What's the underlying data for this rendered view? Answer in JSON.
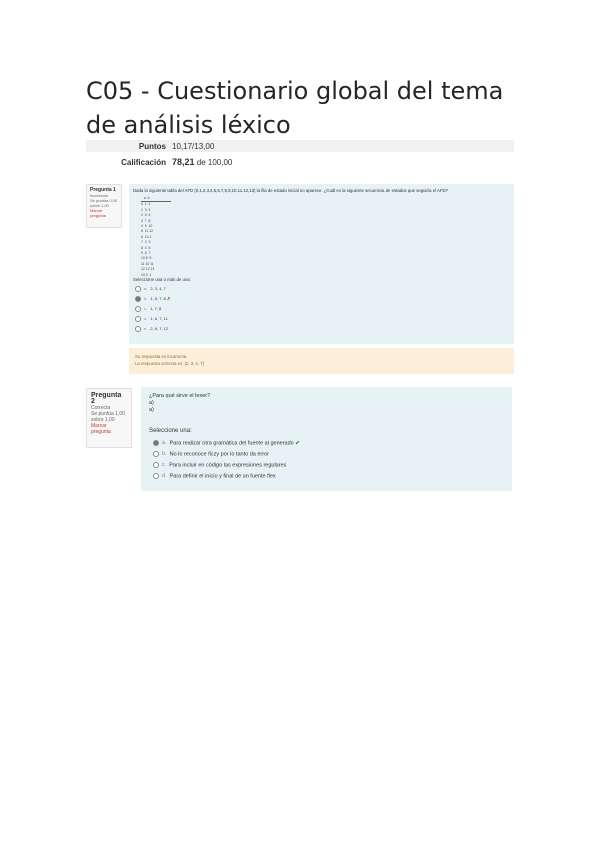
{
  "title": "C05 - Cuestionario global del tema de análisis léxico",
  "summary": {
    "puntos_label": "Puntos",
    "puntos_value": "10,17/13,00",
    "calificacion_label": "Calificación",
    "calificacion_value": "78,21",
    "calificacion_suffix": "de 100,00"
  },
  "q1": {
    "number": "Pregunta 1",
    "state": "Incorrecta",
    "score": "Se puntúa 0,00 sobre 1,00",
    "flag": "Marcar pregunta",
    "text": "Dada la siguiente tabla del AFD (0,1,2,3,4,5,6,7,8,9,10,11,12,13) la fila de estado inicial no aparece. ¿Cuál es la siguiente secuencia de estados que seguiría el AFD?",
    "prompt": "Seleccione una o más de una:",
    "options": [
      {
        "letter": "a.",
        "text": "2, 3, 4, 7",
        "mark": ""
      },
      {
        "letter": "b.",
        "text": "1, 5, 7, 8",
        "mark": "✗"
      },
      {
        "letter": "c.",
        "text": "1, 7, 8",
        "mark": ""
      },
      {
        "letter": "d.",
        "text": "1, 6, 7, 11",
        "mark": ""
      },
      {
        "letter": "e.",
        "text": "2, 6, 7, 12",
        "mark": ""
      }
    ],
    "feedback_line1": "Su respuesta es incorrecta.",
    "feedback_line2": "La respuesta correcta es: [2, 3, 4, 7]"
  },
  "q2": {
    "number": "Pregunta 2",
    "state": "Correcta",
    "score": "Se puntúa 1,00 sobre 1,00",
    "flag": "Marcar pregunta",
    "text_line1": "¿Para qué sirve el lexer?",
    "text_line2": "a)",
    "text_line3": "a)",
    "prompt": "Seleccione una:",
    "options": [
      {
        "letter": "a.",
        "text": "Para realizar otra gramática del fuente al generado",
        "mark": "✔"
      },
      {
        "letter": "b.",
        "text": "No lo reconoce ficzy por lo tanto da error",
        "mark": ""
      },
      {
        "letter": "c.",
        "text": "Para incluir en código las expresiones regulares",
        "mark": ""
      },
      {
        "letter": "d.",
        "text": "Para definir el inicio y final de un fuente flex",
        "mark": ""
      }
    ]
  }
}
